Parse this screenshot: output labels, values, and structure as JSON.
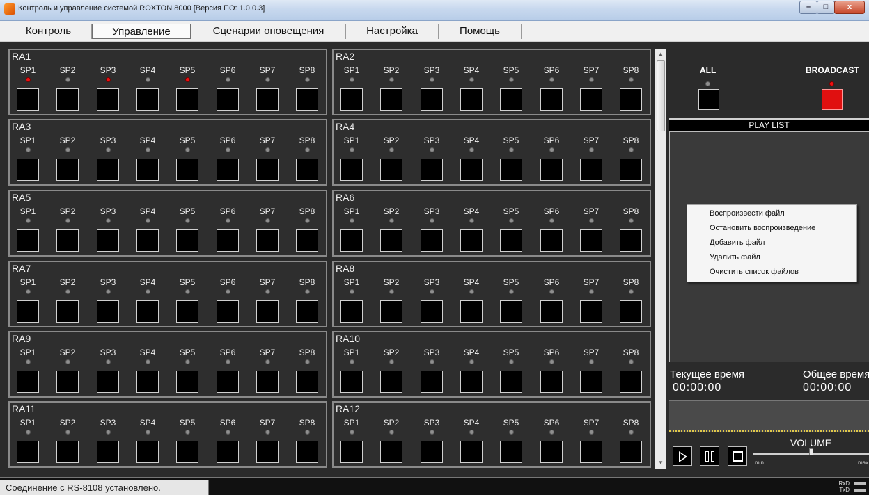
{
  "window": {
    "title": "Контроль и управление системой ROXTON 8000 [Версия ПО: 1.0.0.3]",
    "controls": [
      "–",
      "□",
      "x"
    ]
  },
  "menu": {
    "items": [
      "Контроль",
      "Управление",
      "Сценарии оповещения",
      "Настройка",
      "Помощь"
    ],
    "active": "Управление"
  },
  "zones": [
    {
      "title": "RA1",
      "speakers": [
        "SP1",
        "SP2",
        "SP3",
        "SP4",
        "SP5",
        "SP6",
        "SP7",
        "SP8"
      ],
      "active": [
        true,
        false,
        true,
        false,
        true,
        false,
        false,
        false
      ]
    },
    {
      "title": "RA2",
      "speakers": [
        "SP1",
        "SP2",
        "SP3",
        "SP4",
        "SP5",
        "SP6",
        "SP7",
        "SP8"
      ],
      "active": [
        false,
        false,
        false,
        false,
        false,
        false,
        false,
        false
      ]
    },
    {
      "title": "RA3",
      "speakers": [
        "SP1",
        "SP2",
        "SP3",
        "SP4",
        "SP5",
        "SP6",
        "SP7",
        "SP8"
      ],
      "active": [
        false,
        false,
        false,
        false,
        false,
        false,
        false,
        false
      ]
    },
    {
      "title": "RA4",
      "speakers": [
        "SP1",
        "SP2",
        "SP3",
        "SP4",
        "SP5",
        "SP6",
        "SP7",
        "SP8"
      ],
      "active": [
        false,
        false,
        false,
        false,
        false,
        false,
        false,
        false
      ]
    },
    {
      "title": "RA5",
      "speakers": [
        "SP1",
        "SP2",
        "SP3",
        "SP4",
        "SP5",
        "SP6",
        "SP7",
        "SP8"
      ],
      "active": [
        false,
        false,
        false,
        false,
        false,
        false,
        false,
        false
      ]
    },
    {
      "title": "RA6",
      "speakers": [
        "SP1",
        "SP2",
        "SP3",
        "SP4",
        "SP5",
        "SP6",
        "SP7",
        "SP8"
      ],
      "active": [
        false,
        false,
        false,
        false,
        false,
        false,
        false,
        false
      ]
    },
    {
      "title": "RA7",
      "speakers": [
        "SP1",
        "SP2",
        "SP3",
        "SP4",
        "SP5",
        "SP6",
        "SP7",
        "SP8"
      ],
      "active": [
        false,
        false,
        false,
        false,
        false,
        false,
        false,
        false
      ]
    },
    {
      "title": "RA8",
      "speakers": [
        "SP1",
        "SP2",
        "SP3",
        "SP4",
        "SP5",
        "SP6",
        "SP7",
        "SP8"
      ],
      "active": [
        false,
        false,
        false,
        false,
        false,
        false,
        false,
        false
      ]
    },
    {
      "title": "RA9",
      "speakers": [
        "SP1",
        "SP2",
        "SP3",
        "SP4",
        "SP5",
        "SP6",
        "SP7",
        "SP8"
      ],
      "active": [
        false,
        false,
        false,
        false,
        false,
        false,
        false,
        false
      ]
    },
    {
      "title": "RA10",
      "speakers": [
        "SP1",
        "SP2",
        "SP3",
        "SP4",
        "SP5",
        "SP6",
        "SP7",
        "SP8"
      ],
      "active": [
        false,
        false,
        false,
        false,
        false,
        false,
        false,
        false
      ]
    },
    {
      "title": "RA11",
      "speakers": [
        "SP1",
        "SP2",
        "SP3",
        "SP4",
        "SP5",
        "SP6",
        "SP7",
        "SP8"
      ],
      "active": [
        false,
        false,
        false,
        false,
        false,
        false,
        false,
        false
      ]
    },
    {
      "title": "RA12",
      "speakers": [
        "SP1",
        "SP2",
        "SP3",
        "SP4",
        "SP5",
        "SP6",
        "SP7",
        "SP8"
      ],
      "active": [
        false,
        false,
        false,
        false,
        false,
        false,
        false,
        false
      ]
    }
  ],
  "all": {
    "label": "ALL",
    "active": false
  },
  "broadcast": {
    "label": "BROADCAST",
    "active": true
  },
  "playlist": {
    "header": "PLAY LIST",
    "context_menu": [
      "Воспроизвести файл",
      "Остановить воспроизведение",
      "Добавить файл",
      "Удалить файл",
      "Очистить список файлов"
    ]
  },
  "time": {
    "current_label": "Текущее время",
    "current_value": "00:00:00",
    "total_label": "Общее время",
    "total_value": "00:00:00"
  },
  "volume": {
    "label": "VOLUME",
    "min_label": "min",
    "max_label": "max",
    "level": 0.5
  },
  "status": {
    "text": "Соединение с RS-8108 установлено.",
    "rxd": "RxD",
    "txd": "TxD"
  },
  "colors": {
    "led_on": "#ee1111",
    "led_off": "#8f8f8f",
    "panel_bg": "#2e2e2e"
  }
}
